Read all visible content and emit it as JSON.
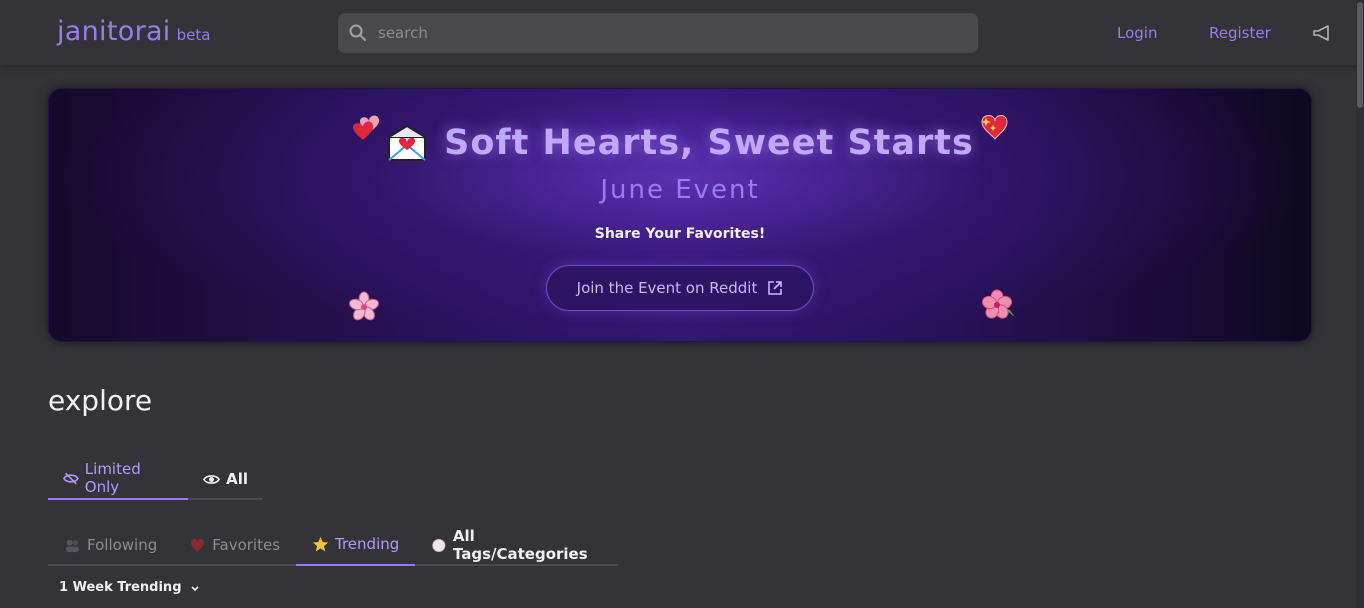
{
  "header": {
    "logo": "janitorai",
    "logo_badge": "beta",
    "search_placeholder": "search",
    "login_label": "Login",
    "register_label": "Register",
    "announcement_icon": "megaphone-icon"
  },
  "banner": {
    "title": "Soft Hearts, Sweet Starts",
    "subtitle": "June Event",
    "tagline": "Share Your Favorites!",
    "button_label": "Join the Event on Reddit",
    "icons": [
      "envelope-heart-icon",
      "two-hearts-icon",
      "sparkling-heart-icon",
      "cherry-blossom-icon",
      "hibiscus-icon",
      "external-link-icon"
    ]
  },
  "main": {
    "heading": "explore",
    "filter_tabs": [
      {
        "label": "Limited Only",
        "icon": "eye-slash-icon",
        "active": true
      },
      {
        "label": "All",
        "icon": "eye-icon",
        "active": false
      }
    ],
    "category_tabs": [
      {
        "label": "Following",
        "icon": "people-icon",
        "active": false
      },
      {
        "label": "Favorites",
        "icon": "heart-icon",
        "active": false
      },
      {
        "label": "Trending",
        "icon": "star-icon",
        "active": true
      },
      {
        "label": "All Tags/Categories",
        "icon": "circle-icon",
        "active": false
      }
    ],
    "sort_select": {
      "value": "1 Week Trending"
    }
  },
  "colors": {
    "accent": "#9a7cf0",
    "background": "#333338",
    "banner_purple": "#341772"
  }
}
